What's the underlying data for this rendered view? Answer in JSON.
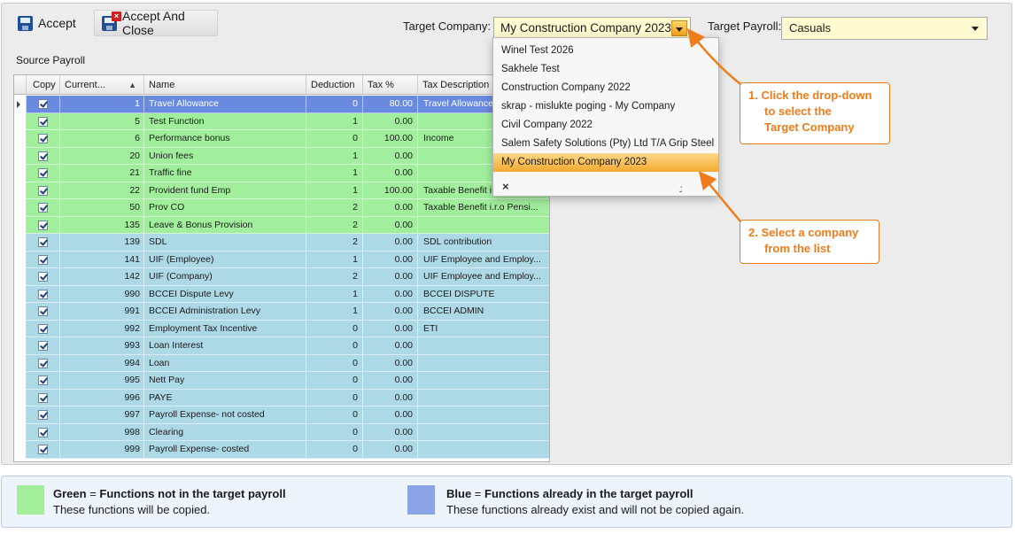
{
  "toolbar": {
    "accept_label": "Accept",
    "accept_close_label": "Accept And Close"
  },
  "target_company": {
    "label": "Target Company:",
    "value": "My Construction Company 2023",
    "options": [
      "Winel Test 2026",
      "Sakhele Test",
      "Construction Company 2022",
      "skrap - mislukte poging - My Company",
      "Civil Company 2022",
      "Salem Safety Solutions (Pty) Ltd T/A Grip Steel",
      "My Construction Company 2023"
    ],
    "selected_option": "My Construction Company 2023",
    "close_symbol": "×",
    "grip_symbol": ".:"
  },
  "target_payroll": {
    "label": "Target Payroll:",
    "value": "Casuals"
  },
  "source_payroll": {
    "label": "Source Payroll",
    "columns": [
      "Copy",
      "Current...",
      "Name",
      "Deduction",
      "Tax %",
      "Tax Description"
    ],
    "sort_indicator": "▲",
    "rows": [
      {
        "copy": true,
        "current": "1",
        "name": "Travel Allowance",
        "deduction": "0",
        "tax": "80.00",
        "desc": "Travel Allowance",
        "status": "selected"
      },
      {
        "copy": true,
        "current": "5",
        "name": "Test Function",
        "deduction": "1",
        "tax": "0.00",
        "desc": "",
        "status": "green"
      },
      {
        "copy": true,
        "current": "6",
        "name": "Performance bonus",
        "deduction": "0",
        "tax": "100.00",
        "desc": "Income",
        "status": "green"
      },
      {
        "copy": true,
        "current": "20",
        "name": "Union fees",
        "deduction": "1",
        "tax": "0.00",
        "desc": "",
        "status": "green"
      },
      {
        "copy": true,
        "current": "21",
        "name": "Traffic fine",
        "deduction": "1",
        "tax": "0.00",
        "desc": "",
        "status": "green"
      },
      {
        "copy": true,
        "current": "22",
        "name": "Provident fund Emp",
        "deduction": "1",
        "tax": "100.00",
        "desc": "Taxable Benefit i.r.o",
        "status": "green"
      },
      {
        "copy": true,
        "current": "50",
        "name": "Prov CO",
        "deduction": "2",
        "tax": "0.00",
        "desc": "Taxable Benefit i.r.o Pensi...",
        "status": "green"
      },
      {
        "copy": true,
        "current": "135",
        "name": "Leave & Bonus Provision",
        "deduction": "2",
        "tax": "0.00",
        "desc": "",
        "status": "green"
      },
      {
        "copy": true,
        "current": "139",
        "name": "SDL",
        "deduction": "2",
        "tax": "0.00",
        "desc": "SDL contribution",
        "status": "blue"
      },
      {
        "copy": true,
        "current": "141",
        "name": "UIF (Employee)",
        "deduction": "1",
        "tax": "0.00",
        "desc": "UIF Employee and Employ...",
        "status": "blue"
      },
      {
        "copy": true,
        "current": "142",
        "name": "UIF (Company)",
        "deduction": "2",
        "tax": "0.00",
        "desc": "UIF Employee and Employ...",
        "status": "blue"
      },
      {
        "copy": true,
        "current": "990",
        "name": "BCCEI Dispute Levy",
        "deduction": "1",
        "tax": "0.00",
        "desc": "BCCEI DISPUTE",
        "status": "blue"
      },
      {
        "copy": true,
        "current": "991",
        "name": "BCCEI Administration Levy",
        "deduction": "1",
        "tax": "0.00",
        "desc": "BCCEI ADMIN",
        "status": "blue"
      },
      {
        "copy": true,
        "current": "992",
        "name": "Employment Tax Incentive",
        "deduction": "0",
        "tax": "0.00",
        "desc": "ETI",
        "status": "blue"
      },
      {
        "copy": true,
        "current": "993",
        "name": "Loan Interest",
        "deduction": "0",
        "tax": "0.00",
        "desc": "",
        "status": "blue"
      },
      {
        "copy": true,
        "current": "994",
        "name": "Loan",
        "deduction": "0",
        "tax": "0.00",
        "desc": "",
        "status": "blue"
      },
      {
        "copy": true,
        "current": "995",
        "name": "Nett Pay",
        "deduction": "0",
        "tax": "0.00",
        "desc": "",
        "status": "blue"
      },
      {
        "copy": true,
        "current": "996",
        "name": "PAYE",
        "deduction": "0",
        "tax": "0.00",
        "desc": "",
        "status": "blue"
      },
      {
        "copy": true,
        "current": "997",
        "name": "Payroll Expense- not costed",
        "deduction": "0",
        "tax": "0.00",
        "desc": "",
        "status": "blue"
      },
      {
        "copy": true,
        "current": "998",
        "name": "Clearing",
        "deduction": "0",
        "tax": "0.00",
        "desc": "",
        "status": "blue"
      },
      {
        "copy": true,
        "current": "999",
        "name": "Payroll Expense- costed",
        "deduction": "0",
        "tax": "0.00",
        "desc": "",
        "status": "blue"
      }
    ]
  },
  "callouts": {
    "step1": [
      "1. Click the drop-down",
      "to select the",
      "Target Company"
    ],
    "step2": [
      "2. Select a company",
      "from the list"
    ]
  },
  "legend": {
    "green_title": "Green",
    "green_eq": " = ",
    "green_meaning": "Functions not in the target payroll",
    "green_desc": "These functions will be copied.",
    "blue_title": "Blue",
    "blue_eq": " = ",
    "blue_meaning": "Functions already in the target payroll",
    "blue_desc": "These functions already exist and will not be copied again."
  },
  "colors": {
    "green_row": "#a1ef9d",
    "blue_row": "#add8e6",
    "selected_row": "#6a8ae0",
    "accent_orange": "#ef7c1b",
    "field_bg": "#fffbd0"
  }
}
